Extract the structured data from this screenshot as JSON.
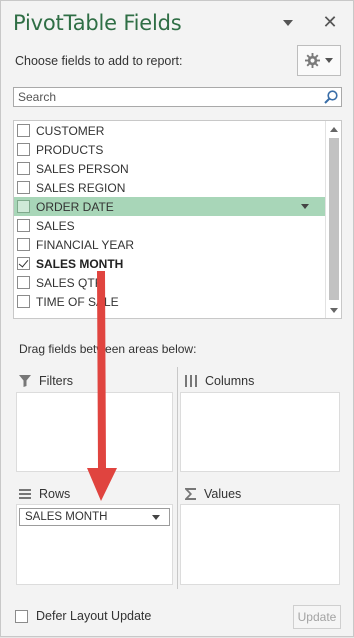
{
  "header": {
    "title": "PivotTable Fields",
    "close_glyph": "✕"
  },
  "choose_label": "Choose fields to add to report:",
  "search": {
    "placeholder": "Search"
  },
  "fields": [
    {
      "label": "CUSTOMER",
      "checked": false
    },
    {
      "label": "PRODUCTS",
      "checked": false
    },
    {
      "label": "SALES PERSON",
      "checked": false
    },
    {
      "label": "SALES REGION",
      "checked": false
    },
    {
      "label": "ORDER DATE",
      "checked": false,
      "highlighted": true
    },
    {
      "label": "SALES",
      "checked": false
    },
    {
      "label": "FINANCIAL YEAR",
      "checked": false
    },
    {
      "label": "SALES MONTH",
      "checked": true
    },
    {
      "label": "SALES QTR",
      "checked": false
    },
    {
      "label": "TIME OF SALE",
      "checked": false
    }
  ],
  "drag_hint": "Drag fields between areas below:",
  "areas": {
    "filters": {
      "label": "Filters",
      "icon": "filter-icon"
    },
    "columns": {
      "label": "Columns",
      "icon": "columns-icon"
    },
    "rows": {
      "label": "Rows",
      "icon": "rows-icon",
      "items": [
        "SALES MONTH"
      ]
    },
    "values": {
      "label": "Values",
      "icon": "sigma-icon"
    }
  },
  "footer": {
    "defer_label": "Defer Layout Update",
    "update_label": "Update"
  },
  "colors": {
    "title": "#2f6e45",
    "highlight_row": "#a8d6b8",
    "annotation_arrow": "#e0443f"
  }
}
